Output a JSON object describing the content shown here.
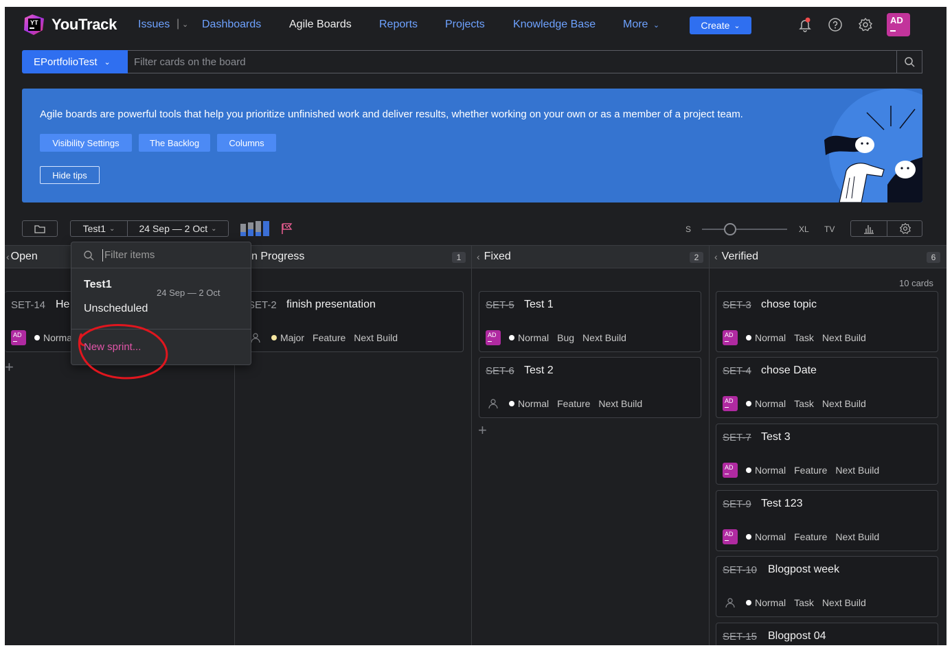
{
  "nav": {
    "logo_text": "YouTrack",
    "logo_badge": "YT",
    "issues": "Issues",
    "issues_sep": "|",
    "dashboards": "Dashboards",
    "agile_boards": "Agile Boards",
    "reports": "Reports",
    "projects": "Projects",
    "knowledge_base": "Knowledge Base",
    "more": "More",
    "create": "Create",
    "user_initials": "AD"
  },
  "board": {
    "selected": "EPortfolioTest",
    "filter_placeholder": "Filter cards on the board"
  },
  "tips": {
    "text": "Agile boards are powerful tools that help you prioritize unfinished work and deliver results, whether working on your own or as a member of a project team.",
    "buttons": [
      "Visibility Settings",
      "The Backlog",
      "Columns"
    ],
    "hide": "Hide tips"
  },
  "toolbar": {
    "sprint": "Test1",
    "dates": "24 Sep — 2 Oct",
    "size_s": "S",
    "size_xl": "XL",
    "size_tv": "TV"
  },
  "columns": [
    {
      "name": "Open",
      "count": ""
    },
    {
      "name": "n Progress",
      "count": "1"
    },
    {
      "name": "Fixed",
      "count": "2"
    },
    {
      "name": "Verified",
      "count": "6"
    }
  ],
  "cards_count": "10 cards",
  "cards": {
    "open": [
      {
        "id": "SET-14",
        "title": "He",
        "assignee": "AD",
        "priority": "Normal",
        "extra": []
      }
    ],
    "in_progress": [
      {
        "id": "SET-2",
        "title": "finish presentation",
        "assignee": "",
        "priority": "Major",
        "extra": [
          "Feature",
          "Next Build"
        ]
      }
    ],
    "fixed": [
      {
        "id": "SET-5",
        "title": "Test 1",
        "assignee": "AD",
        "priority": "Normal",
        "extra": [
          "Bug",
          "Next Build"
        ]
      },
      {
        "id": "SET-6",
        "title": "Test 2",
        "assignee": "",
        "priority": "Normal",
        "extra": [
          "Feature",
          "Next Build"
        ]
      }
    ],
    "verified": [
      {
        "id": "SET-3",
        "title": "chose topic",
        "assignee": "AD",
        "priority": "Normal",
        "extra": [
          "Task",
          "Next Build"
        ]
      },
      {
        "id": "SET-4",
        "title": "chose Date",
        "assignee": "AD",
        "priority": "Normal",
        "extra": [
          "Task",
          "Next Build"
        ]
      },
      {
        "id": "SET-7",
        "title": "Test 3",
        "assignee": "AD",
        "priority": "Normal",
        "extra": [
          "Feature",
          "Next Build"
        ]
      },
      {
        "id": "SET-9",
        "title": "Test 123",
        "assignee": "AD",
        "priority": "Normal",
        "extra": [
          "Feature",
          "Next Build"
        ]
      },
      {
        "id": "SET-10",
        "title": "Blogpost week",
        "assignee": "",
        "priority": "Normal",
        "extra": [
          "Task",
          "Next Build"
        ]
      },
      {
        "id": "SET-15",
        "title": "Blogpost 04",
        "assignee": "",
        "priority": "",
        "extra": []
      }
    ]
  },
  "sprint_dropdown": {
    "filter_placeholder": "Filter items",
    "items": [
      {
        "name": "Test1",
        "dates": "24 Sep — 2 Oct"
      },
      {
        "name": "Unscheduled",
        "dates": ""
      }
    ],
    "new_sprint": "New sprint..."
  },
  "colors": {
    "background": "#1e1f22",
    "accent": "#2f6ff0",
    "link": "#6ea2ff",
    "banner": "#3574d0",
    "avatar": "#b02aa1",
    "new_sprint": "#e055a8",
    "annotation": "#e0161e"
  },
  "icons": [
    "youtrack-logo-icon",
    "chevron-down-icon",
    "bell-icon",
    "help-icon",
    "gear-icon",
    "search-icon",
    "folder-icon",
    "swimlane-chart-icon",
    "flag-icon",
    "bar-chart-icon",
    "unassigned-user-icon",
    "plus-icon"
  ]
}
